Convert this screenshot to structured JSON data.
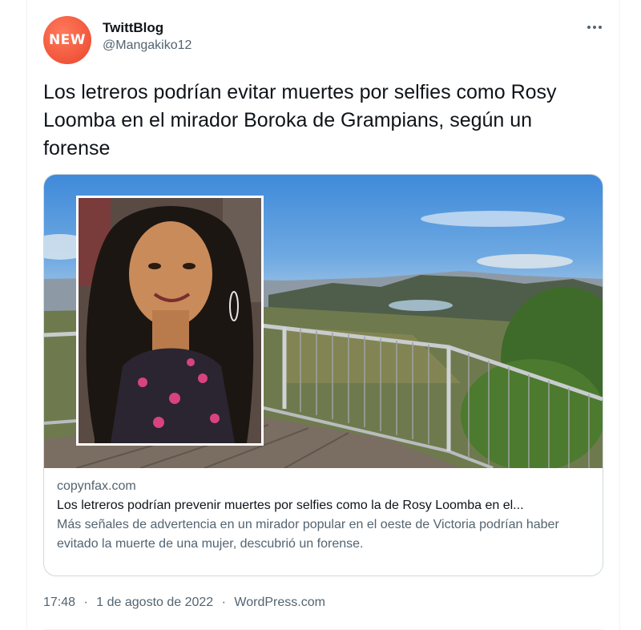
{
  "author": {
    "avatar_text": "NEW",
    "display_name": "TwittBlog",
    "handle": "@Mangakiko12"
  },
  "tweet": {
    "text": "Los letreros podrían evitar muertes por selfies como Rosy Loomba en el mirador Boroka de Grampians, según un forense"
  },
  "card": {
    "domain": "copynfax.com",
    "title": "Los letreros podrían prevenir muertes por selfies como la de Rosy Loomba en el...",
    "description": "Más señales de advertencia en un mirador popular en el oeste de Victoria podrían haber evitado la muerte de una mujer, descubrió un forense."
  },
  "footer": {
    "time": "17:48",
    "date": "1 de agosto de 2022",
    "source": "WordPress.com",
    "separator": "·"
  },
  "icons": {
    "more": "more-horizontal-icon"
  },
  "colors": {
    "text_primary": "#0f1419",
    "text_secondary": "#536471",
    "border": "#cfd9de",
    "avatar_bg": "#f0553a"
  }
}
